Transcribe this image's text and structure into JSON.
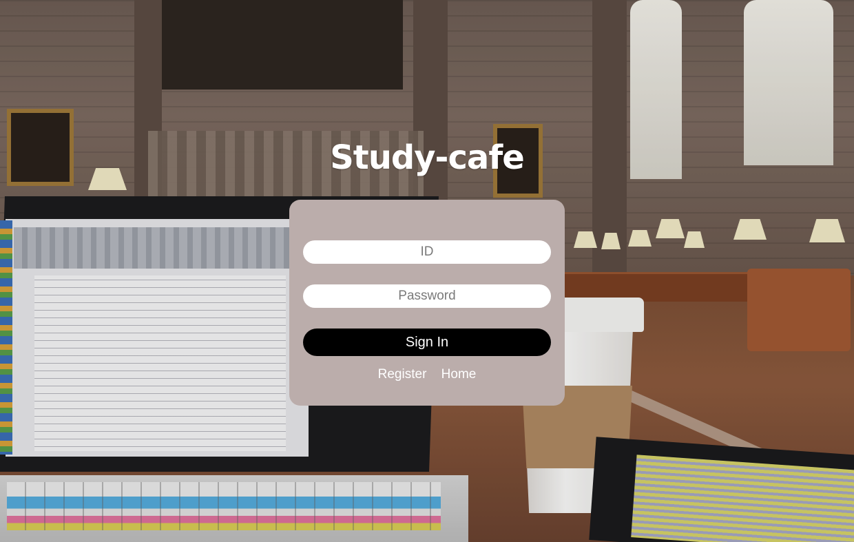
{
  "app": {
    "title": "Study-cafe"
  },
  "login": {
    "id_placeholder": "ID",
    "password_placeholder": "Password",
    "sign_in_label": "Sign In",
    "links": {
      "register_label": "Register",
      "home_label": "Home"
    }
  },
  "colors": {
    "card_background": "#bbadab",
    "button_background": "#000000",
    "input_background": "#ffffff",
    "text_light": "#ffffff"
  }
}
